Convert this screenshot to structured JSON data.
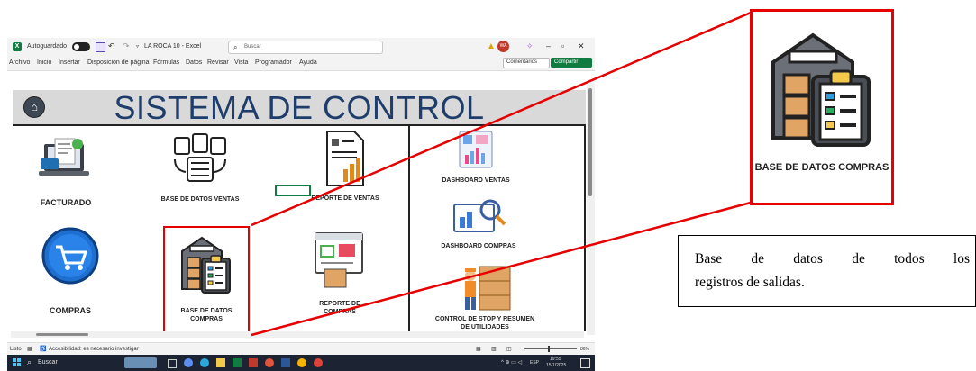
{
  "excel": {
    "autosave_label": "Autoguardado",
    "file_title": "LA ROCA 10 - Excel",
    "search_placeholder": "Buscar",
    "user_initials": "WA",
    "menu_items": [
      "Archivo",
      "Inicio",
      "Insertar",
      "Disposición de página",
      "Fórmulas",
      "Datos",
      "Revisar",
      "Vista",
      "Programador",
      "Ayuda"
    ],
    "comments_label": "Comentarios",
    "share_label": "Compartir"
  },
  "dashboard": {
    "title": "SISTEMA DE CONTROL",
    "tiles": {
      "facturado": "FACTURADO",
      "compras": "COMPRAS",
      "bd_ventas": "BASE DE DATOS VENTAS",
      "bd_compras": "BASE DE DATOS COMPRAS",
      "reporte_ventas": "REPORTE DE VENTAS",
      "reporte_compras": "REPORTE DE COMPRAS",
      "dashboard_ventas": "DASHBOARD VENTAS",
      "dashboard_compras": "DASHBOARD COMPRAS",
      "control_stop": "CONTROL DE STOP Y RESUMEN DE UTILIDADES"
    }
  },
  "status": {
    "ready": "Listo",
    "accessibility": "Accesibilidad: es necesario investigar",
    "zoom": "86%"
  },
  "taskbar": {
    "search_placeholder": "Buscar",
    "lang": "ESP",
    "time": "19:55",
    "date": "15/1/2025"
  },
  "callout": {
    "label": "BASE DE DATOS COMPRAS"
  },
  "description": {
    "line1": "Base de datos de todos los",
    "line2": "registros de salidas."
  },
  "colors": {
    "highlight": "#e60000",
    "title_text": "#1f3d6b",
    "excel_green": "#107c41"
  }
}
